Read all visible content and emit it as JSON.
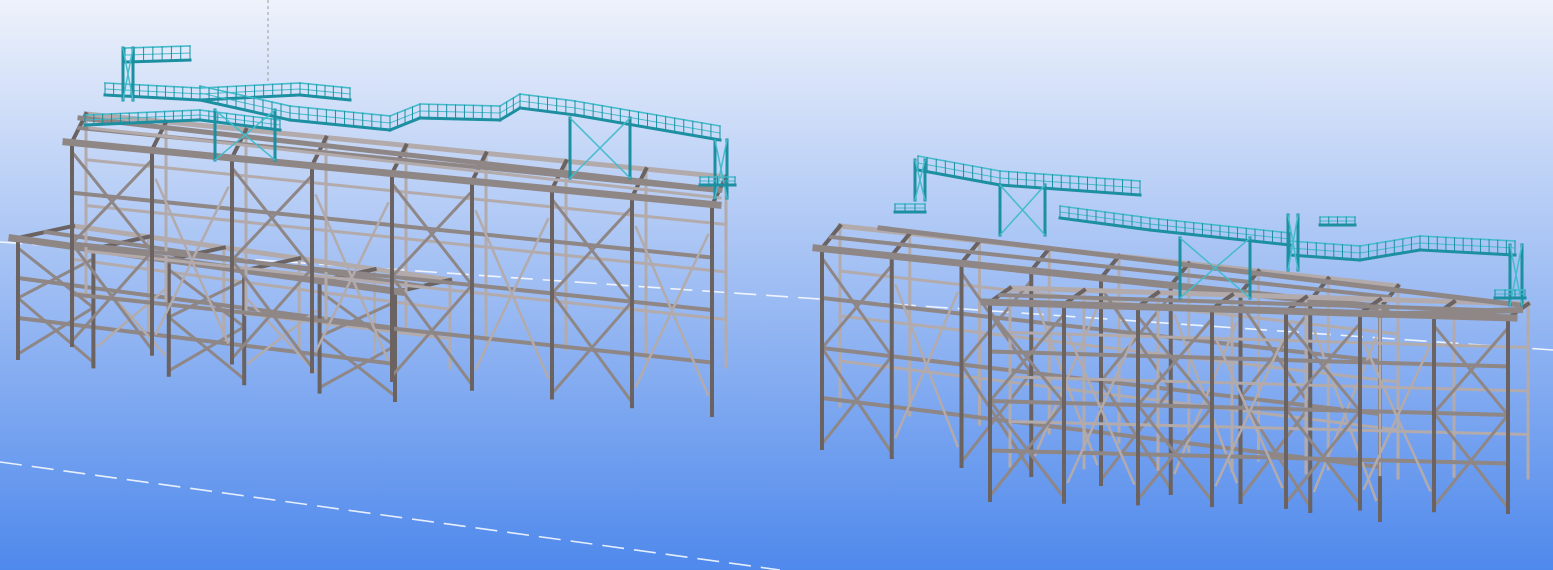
{
  "viewport": {
    "kind": "3D model view",
    "background_top": "#eef2fb",
    "background_bottom": "#4f89ec",
    "grid_line_color": "#ffffff",
    "axis_line_color": "#9a9a9a"
  },
  "colors": {
    "steel": "#8f8686",
    "steel_dark": "#6b6262",
    "steel_light": "#b3abab",
    "walkway": "#1c8fa0",
    "walkway_light": "#44bccb"
  },
  "models": [
    {
      "id": "model-left",
      "description_label": ""
    },
    {
      "id": "model-right",
      "description_label": ""
    }
  ]
}
